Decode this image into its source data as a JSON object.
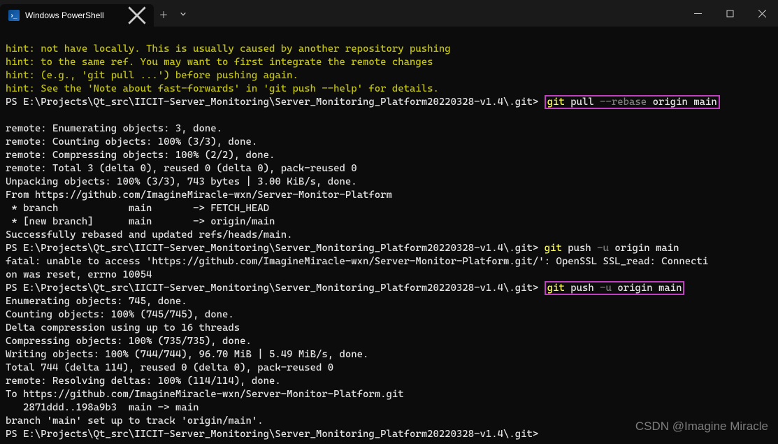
{
  "tab": {
    "title": "Windows PowerShell"
  },
  "hints": [
    "hint: not have locally. This is usually caused by another repository pushing",
    "hint: to the same ref. You may want to first integrate the remote changes",
    "hint: (e.g., 'git pull ...') before pushing again.",
    "hint: See the 'Note about fast-forwards' in 'git push --help' for details."
  ],
  "prompt": "PS E:\\Projects\\Qt_src\\IICIT-Server_Monitoring\\Server_Monitoring_Platform20220328-v1.4\\.git>",
  "cmd1": {
    "git": "git",
    "sub": "pull",
    "flag": "--rebase",
    "a1": "origin",
    "a2": "main"
  },
  "block1": [
    "remote: Enumerating objects: 3, done.",
    "remote: Counting objects: 100% (3/3), done.",
    "remote: Compressing objects: 100% (2/2), done.",
    "remote: Total 3 (delta 0), reused 0 (delta 0), pack-reused 0",
    "Unpacking objects: 100% (3/3), 743 bytes | 3.00 KiB/s, done.",
    "From https://github.com/ImagineMiracle-wxn/Server-Monitor-Platform",
    " * branch            main       -> FETCH_HEAD",
    " * [new branch]      main       -> origin/main",
    "Successfully rebased and updated refs/heads/main."
  ],
  "cmd2": {
    "git": "git",
    "sub": "push",
    "flag": "-u",
    "a1": "origin",
    "a2": "main"
  },
  "err": [
    "fatal: unable to access 'https://github.com/ImagineMiracle-wxn/Server-Monitor-Platform.git/': OpenSSL SSL_read: Connecti",
    "on was reset, errno 10054"
  ],
  "cmd3": {
    "git": "git",
    "sub": "push",
    "flag": "-u",
    "a1": "origin",
    "a2": "main"
  },
  "block2": [
    "Enumerating objects: 745, done.",
    "Counting objects: 100% (745/745), done.",
    "Delta compression using up to 16 threads",
    "Compressing objects: 100% (735/735), done.",
    "Writing objects: 100% (744/744), 96.70 MiB | 5.49 MiB/s, done.",
    "Total 744 (delta 114), reused 0 (delta 0), pack-reused 0",
    "remote: Resolving deltas: 100% (114/114), done.",
    "To https://github.com/ImagineMiracle-wxn/Server-Monitor-Platform.git",
    "   2871ddd..198a9b3  main -> main",
    "branch 'main' set up to track 'origin/main'."
  ],
  "watermark": "CSDN @Imagine Miracle"
}
